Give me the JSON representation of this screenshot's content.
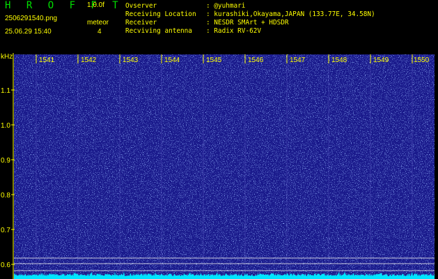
{
  "header": {
    "app_title": "H R O F F T",
    "app_version": "1.0.0f",
    "file_name": "2506291540.png",
    "timestamp": "25.06.29 15:40",
    "mode_label": "meteor",
    "mode_value": "4"
  },
  "info": [
    {
      "label": "Ovserver",
      "value": ": @yuhmari"
    },
    {
      "label": "Receiving Location",
      "value": ": kurashiki,Okayama,JAPAN (133.77E, 34.58N)"
    },
    {
      "label": "Receiver",
      "value": ": NESDR SMArt + HDSDR"
    },
    {
      "label": "Recviving antenna",
      "value": ": Radix RV-62V"
    }
  ],
  "colors": {
    "text": "#ffff00",
    "title": "#00e000",
    "spectrum_bg": "#1a1a8c",
    "noise": "#4a7bff",
    "baseline": "#00e5ff"
  },
  "y_axis": {
    "unit": "kHz",
    "ticks": [
      "1.1",
      "1.0",
      "0.9",
      "0.8",
      "0.7",
      "0.6"
    ]
  },
  "x_axis": {
    "ticks": [
      "1541",
      "1542",
      "1543",
      "1544",
      "1545",
      "1546",
      "1547",
      "1548",
      "1549",
      "1550"
    ]
  }
}
